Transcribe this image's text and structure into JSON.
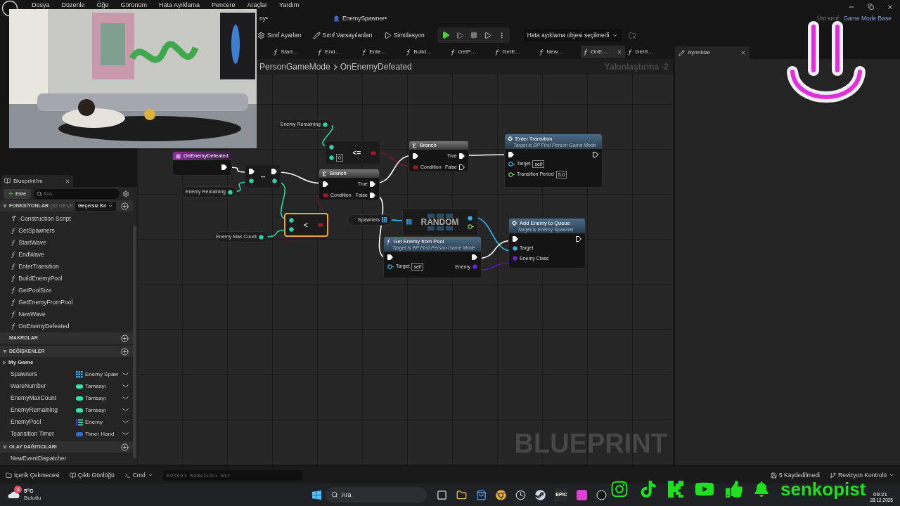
{
  "menu": [
    "Dosya",
    "Düzenle",
    "Öğe",
    "Görünüm",
    "Hata Ayıklama",
    "Pencere",
    "Araçlar",
    "Yardım"
  ],
  "document_tabs": [
    {
      "label": "ny•"
    },
    {
      "label": "EnemySpawner•"
    }
  ],
  "parent_class": {
    "label": "Üst sınıf:",
    "value": "Game Mode Base"
  },
  "toolbar": {
    "buttons": [
      "Sınıf Ayarları",
      "Sınıf Varsayılanları",
      "Simülasyon"
    ],
    "debug_dropdown": "Hata ayıklama objesi seçilmedi"
  },
  "graph_tabs": [
    {
      "label": "Start…",
      "selected": false
    },
    {
      "label": "End…",
      "selected": false
    },
    {
      "label": "Ente…",
      "selected": false
    },
    {
      "label": "Build…",
      "selected": false
    },
    {
      "label": "GetP…",
      "selected": false
    },
    {
      "label": "GetE…",
      "selected": false
    },
    {
      "label": "New…",
      "selected": false
    },
    {
      "label": "OnE…",
      "selected": true
    },
    {
      "label": "GetS…",
      "selected": false
    }
  ],
  "details_tab": "Ayrıntılar",
  "graph": {
    "breadcrumb": [
      "PersonGameMode",
      "OnEnemyDefeated"
    ],
    "zoom": "Yakınlaştırma -2",
    "watermark": "BLUEPRINT",
    "nodes": [
      {
        "kind": "event",
        "title": "OnEnemyDefeated"
      },
      {
        "kind": "operator",
        "symbol": "--",
        "selected": false
      },
      {
        "kind": "getter",
        "label": "Enemy Remaining"
      },
      {
        "kind": "operator",
        "symbol": "<=",
        "value": "0",
        "selected": false
      },
      {
        "kind": "getter",
        "label": "Enemy Remaining"
      },
      {
        "kind": "branch",
        "title": "Branch",
        "condition": "Condition",
        "true_label": "True",
        "false_label": "False"
      },
      {
        "kind": "branch",
        "title": "Branch",
        "condition": "Condition",
        "true_label": "True",
        "false_label": "False"
      },
      {
        "kind": "function",
        "title": "Enter Transition",
        "subtitle": "Target is BP First Person Game Mode",
        "inputs": [
          {
            "label": "Target",
            "value": "self"
          },
          {
            "label": "Transition Period",
            "value": "5.0"
          }
        ]
      },
      {
        "kind": "getter",
        "label": "Enemy Max Count"
      },
      {
        "kind": "operator",
        "symbol": "<",
        "selected": true
      },
      {
        "kind": "getter",
        "label": "Spawners"
      },
      {
        "kind": "random",
        "title": "RANDOM"
      },
      {
        "kind": "function",
        "title": "Get Enemy from Pool",
        "subtitle": "Target is BP First Person Game Mode",
        "inputs": [
          {
            "label": "Target",
            "value": "self"
          }
        ],
        "outputs": [
          {
            "label": "Enemy"
          }
        ]
      },
      {
        "kind": "function",
        "title": "Add Enemy to Queue",
        "subtitle": "Target is Enemy Spawner",
        "inputs": [
          {
            "label": "Target"
          },
          {
            "label": "Enemy Class"
          }
        ]
      }
    ]
  },
  "my_blueprint": {
    "tab": "Blueprint'im",
    "add_button": "Ekle",
    "search_placeholder": "Ara",
    "functions": {
      "title": "FONKSİYONLAR",
      "note": "(32 GEÇE",
      "filter": "Geçersiz Kıl",
      "expanded": true,
      "items": [
        {
          "label": "Construction Script",
          "kind": "construction"
        },
        {
          "label": "GetSpawners",
          "kind": "function"
        },
        {
          "label": "StartWave",
          "kind": "function"
        },
        {
          "label": "EndWave",
          "kind": "function"
        },
        {
          "label": "EnterTransition",
          "kind": "function"
        },
        {
          "label": "BuildEnemyPool",
          "kind": "function"
        },
        {
          "label": "GetPoolSize",
          "kind": "function"
        },
        {
          "label": "GetEnemyFromPool",
          "kind": "function"
        },
        {
          "label": "NewWave",
          "kind": "function"
        },
        {
          "label": "OnEnemyDefeated",
          "kind": "function"
        }
      ]
    },
    "macros": {
      "title": "MAKROLAR",
      "expanded": false
    },
    "variables": {
      "title": "DEĞİŞKENLER",
      "expanded": true,
      "category": "My Game",
      "items": [
        {
          "name": "Spawners",
          "type": "Enemy Spaw",
          "kind": "array",
          "color": "#3aa6e8"
        },
        {
          "name": "WareNumber",
          "type": "Tamsayı",
          "kind": "single",
          "color": "#2ee8b6"
        },
        {
          "name": "EnemyMaxCount",
          "type": "Tamsayı",
          "kind": "single",
          "color": "#2ee8b6"
        },
        {
          "name": "EnemyRemaining",
          "type": "Tamsayı",
          "kind": "single",
          "color": "#2ee8b6"
        },
        {
          "name": "EnemyPool",
          "type": "Enemy",
          "kind": "list",
          "color": "#27d9a7"
        },
        {
          "name": "Teansition Timer",
          "type": "Timer Hand",
          "kind": "single",
          "color": "#2a6fd8"
        }
      ]
    },
    "dispatchers": {
      "title": "OLAY DAĞITICILARI",
      "expanded": true,
      "items": [
        "NewEventDispatcher"
      ]
    }
  },
  "bottom_bar": {
    "left": [
      "İçerik Çekmecesi",
      "Çıktı Günlüğü"
    ],
    "cmd": "Cmd",
    "console_placeholder": "Konsol Komutunu Gir",
    "unsaved": "5 Kaydedilmedi",
    "revision": "Revizyon Kontrolü"
  },
  "taskbar": {
    "weather": {
      "badge": "3",
      "temperature": "5°C",
      "condition": "Bulutlu"
    },
    "search_placeholder": "Ara",
    "epic_label": "EPIC",
    "time": "09:21",
    "date": "28.12.2025"
  },
  "stream_overlay": {
    "handle": "senkopist"
  }
}
